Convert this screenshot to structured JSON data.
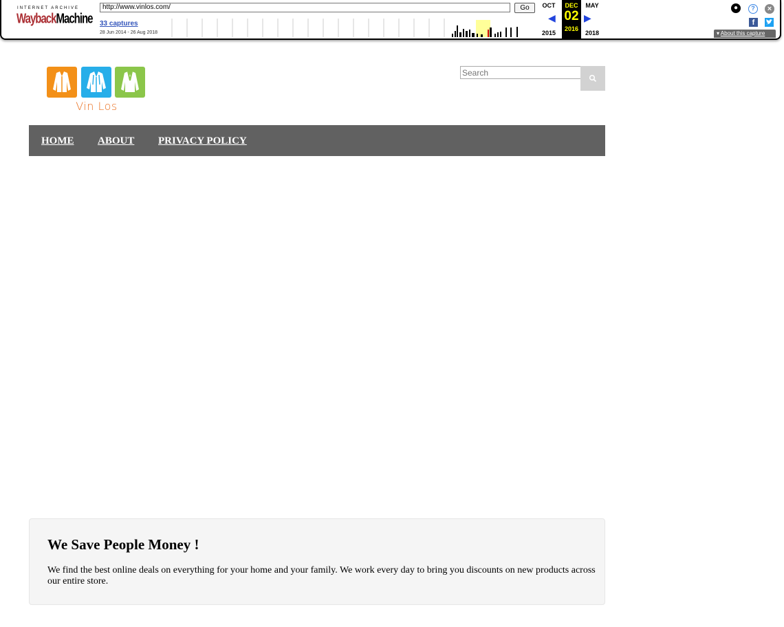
{
  "wayback": {
    "logo_top": "INTERNET ARCHIVE",
    "logo_wayback": "Wayback",
    "logo_machine": "Machine",
    "url": "http://www.vinlos.com/",
    "go_label": "Go",
    "captures": "33 captures",
    "date_range": "28 Jun 2014 - 26 Aug 2018",
    "prev_month": "OCT",
    "current_month": "DEC",
    "current_day": "02",
    "current_year": "2016",
    "next_month": "MAY",
    "prev_year": "2015",
    "next_year": "2018",
    "about_capture": "About this capture",
    "icons": [
      "user-icon",
      "help-icon",
      "close-icon",
      "facebook-icon",
      "twitter-icon"
    ]
  },
  "site": {
    "brand": "Vin Los",
    "search_placeholder": "Search",
    "nav": {
      "home": "HOME",
      "about": "ABOUT",
      "privacy": "PRIVACY POLICY"
    },
    "promo": {
      "title": "We Save People Money !",
      "text": "We find the best online deals on everything for your home and your family. We work every day to bring you discounts on new products across our entire store."
    },
    "colors": {
      "tile_orange": "#f39018",
      "tile_blue": "#27aee9",
      "tile_green": "#8bc64a",
      "brand_text": "#ea6f1e",
      "nav_bg": "#616161"
    }
  }
}
